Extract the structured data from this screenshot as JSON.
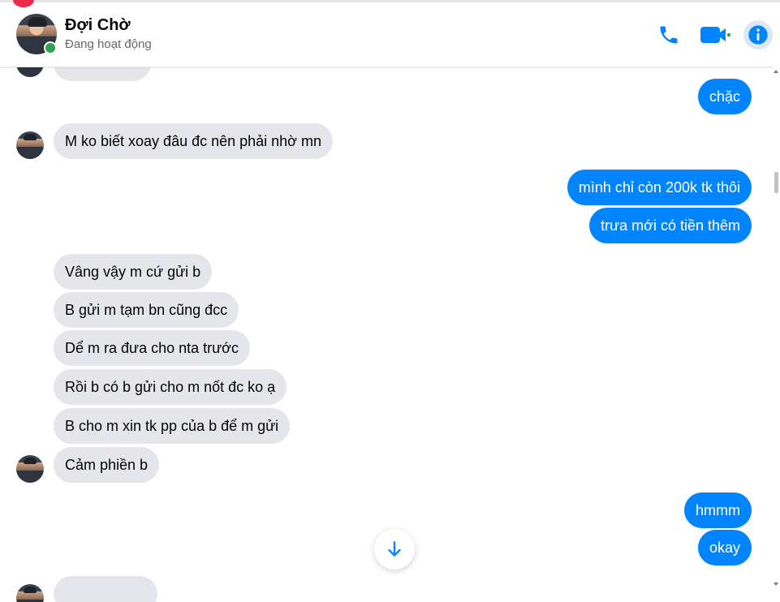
{
  "contact": {
    "name": "Đợi Chờ",
    "status": "Đang hoạt động"
  },
  "header": {
    "call_icon": "phone-icon",
    "video_icon": "video-camera-icon",
    "info_icon": "info-icon",
    "accent_color": "#0084ff"
  },
  "messages": [
    {
      "from": "me",
      "text": "chặc"
    },
    {
      "from": "them",
      "text": "M ko biết xoay đâu đc nên phải nhờ mn"
    },
    {
      "from": "me",
      "text": "mình chỉ còn 200k tk thôi"
    },
    {
      "from": "me",
      "text": "trưa mới có tiền thêm"
    },
    {
      "from": "them",
      "text": "Vâng vậy m cứ gửi b"
    },
    {
      "from": "them",
      "text": "B gửi m tạm bn cũng đcc"
    },
    {
      "from": "them",
      "text": "Dể m ra đưa cho nta trước"
    },
    {
      "from": "them",
      "text": "Rồi b có b gửi cho m nốt đc ko ạ"
    },
    {
      "from": "them",
      "text": "B cho m xin tk pp của b để m gửi"
    },
    {
      "from": "them",
      "text": "Cảm phiền b"
    },
    {
      "from": "me",
      "text": "hmmm"
    },
    {
      "from": "me",
      "text": "okay"
    }
  ],
  "colors": {
    "incoming_bubble": "#e4e6eb",
    "outgoing_bubble": "#0084ff",
    "online": "#31a24c"
  },
  "scroll_down_icon": "arrow-down-icon"
}
